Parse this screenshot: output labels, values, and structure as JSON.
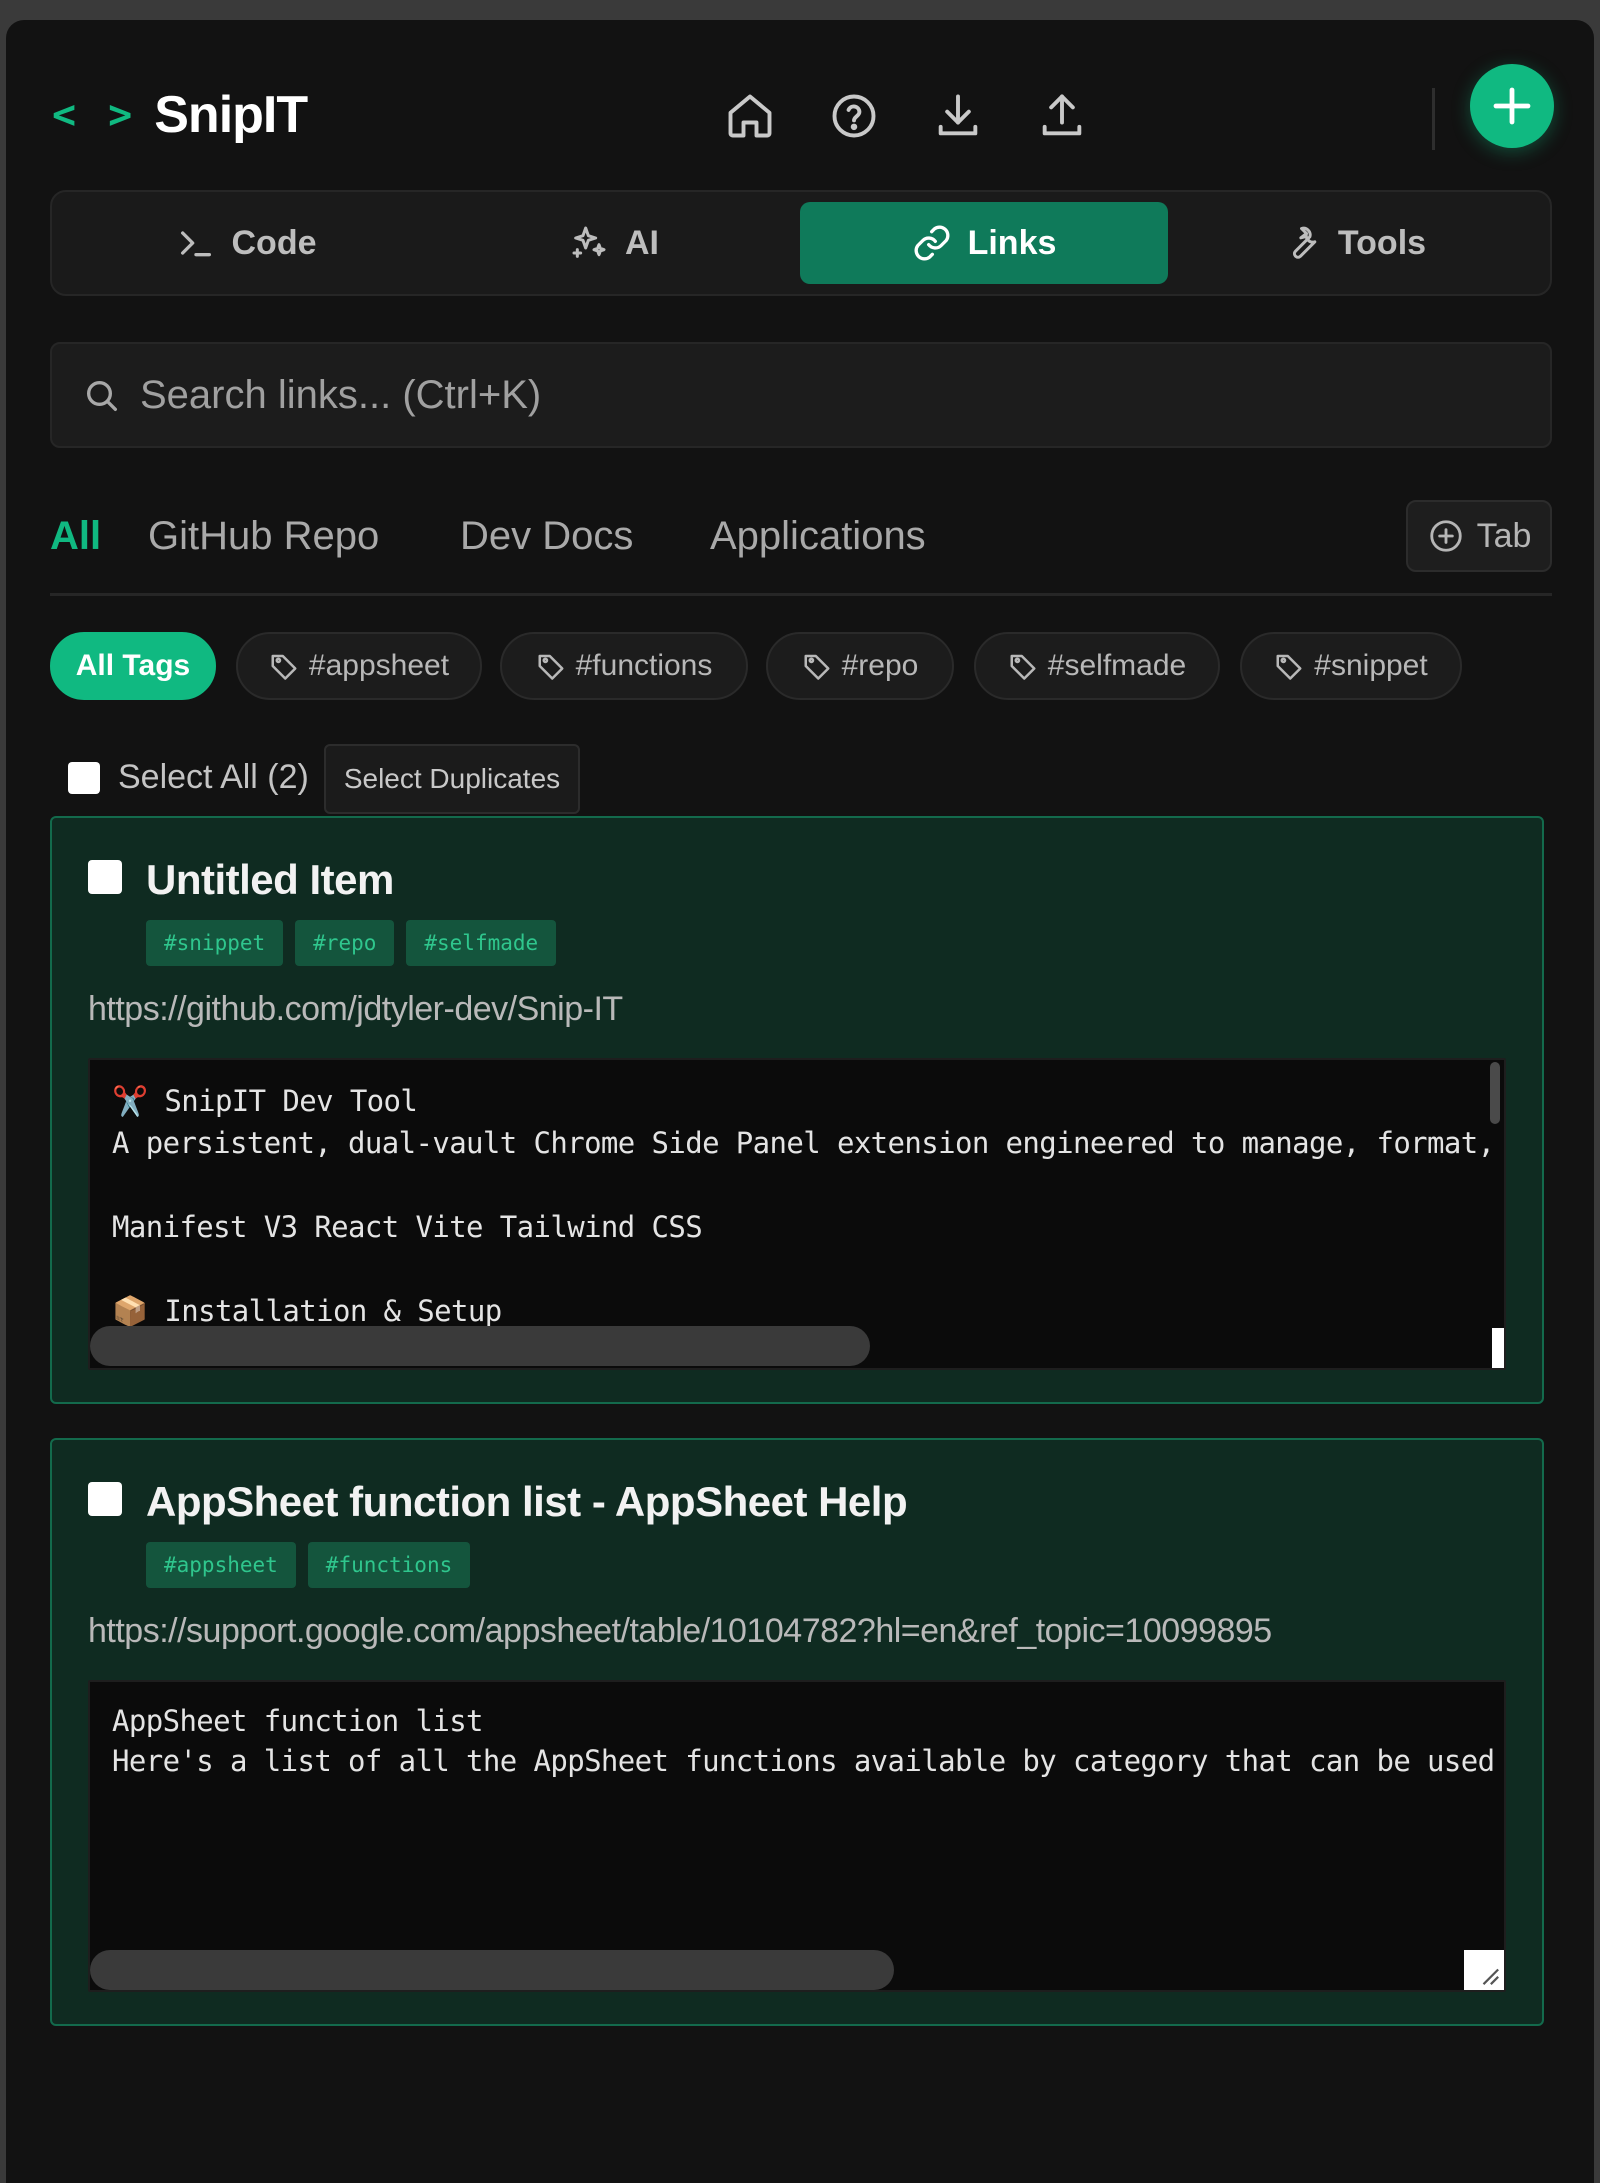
{
  "app": {
    "logo_mark": "< >",
    "title": "SnipIT"
  },
  "header": {
    "buttons": [
      {
        "icon": "home-icon"
      },
      {
        "icon": "help-icon"
      },
      {
        "icon": "download-icon"
      },
      {
        "icon": "upload-icon"
      }
    ],
    "add_icon": "plus-icon"
  },
  "tabs": [
    {
      "label": "Code",
      "icon": "terminal-icon"
    },
    {
      "label": "AI",
      "icon": "sparkles-icon"
    },
    {
      "label": "Links",
      "icon": "link-icon",
      "active": true
    },
    {
      "label": "Tools",
      "icon": "wrench-icon"
    }
  ],
  "search": {
    "placeholder": "Search links... (Ctrl+K)",
    "value": ""
  },
  "categories": [
    {
      "label": "All",
      "active": true
    },
    {
      "label": "GitHub Repo"
    },
    {
      "label": "Dev Docs"
    },
    {
      "label": "Applications"
    }
  ],
  "add_tab_label": "Tab",
  "tags": [
    {
      "label": "All Tags",
      "active": true
    },
    {
      "label": "#appsheet"
    },
    {
      "label": "#functions"
    },
    {
      "label": "#repo"
    },
    {
      "label": "#selfmade"
    },
    {
      "label": "#snippet"
    }
  ],
  "select": {
    "select_all_label": "Select All (2)",
    "duplicates_label": "Select Duplicates"
  },
  "items": [
    {
      "title": "Untitled Item",
      "tags": [
        "#snippet",
        "#repo",
        "#selfmade"
      ],
      "url": "https://github.com/jdtyler-dev/Snip-IT",
      "content_lines": [
        "✂️ SnipIT Dev Tool",
        "A persistent, dual-vault Chrome Side Panel extension engineered to manage, format, an",
        "",
        "Manifest V3 React Vite Tailwind CSS",
        "",
        "📦 Installation & Setup"
      ]
    },
    {
      "title": "AppSheet function list - AppSheet Help",
      "tags": [
        "#appsheet",
        "#functions"
      ],
      "url": "https://support.google.com/appsheet/table/10104782?hl=en&ref_topic=10099895",
      "content_lines": [
        "AppSheet function list",
        "Here's a list of all the AppSheet functions available by category that can be used whe"
      ]
    }
  ],
  "colors": {
    "accent": "#10b981",
    "active_tab": "#0f7a5a",
    "card_bg": "#0f2b21",
    "card_border": "#136a4c"
  }
}
